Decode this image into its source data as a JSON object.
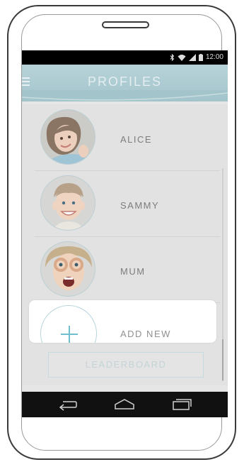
{
  "status_bar": {
    "time": "12:00",
    "icons": [
      "bluetooth-icon",
      "wifi-icon",
      "signal-icon",
      "battery-icon"
    ]
  },
  "app_bar": {
    "title": "PROFILES",
    "menu_icon": "hamburger-menu-icon"
  },
  "profiles": [
    {
      "name": "ALICE",
      "avatar": "girl-avatar"
    },
    {
      "name": "SAMMY",
      "avatar": "boy-avatar"
    },
    {
      "name": "MUM",
      "avatar": "woman-avatar"
    }
  ],
  "add_new": {
    "label": "ADD NEW",
    "icon": "plus-icon"
  },
  "leaderboard": {
    "label": "LEADERBOARD"
  },
  "nav_bar": {
    "icons": [
      "back-icon",
      "home-icon",
      "recents-icon"
    ]
  },
  "colors": {
    "accent": "#6fbfcf",
    "app_bar": "#a3c4cb",
    "status_bar": "#000000",
    "nav_bar": "#111111"
  }
}
